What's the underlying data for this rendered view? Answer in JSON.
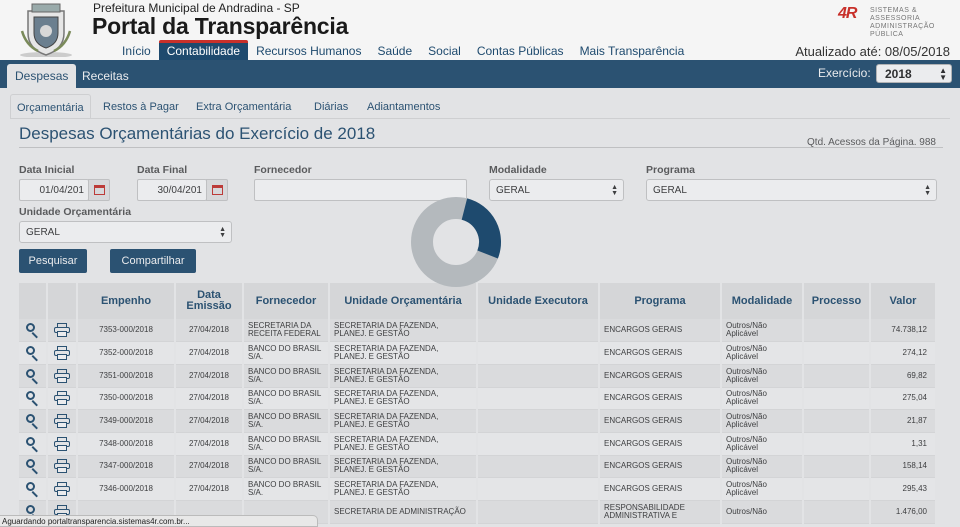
{
  "header": {
    "city": "Prefeitura Municipal de Andradina - SP",
    "portal_title": "Portal da Transparência",
    "updated": "Atualizado até: 08/05/2018",
    "brand": {
      "mark": "4R",
      "line1": "SISTEMAS & ASSESSORIA",
      "line2": "ADMINISTRAÇÃO PÚBLICA"
    },
    "nav": [
      {
        "label": "Início"
      },
      {
        "label": "Contabilidade"
      },
      {
        "label": "Recursos Humanos"
      },
      {
        "label": "Saúde"
      },
      {
        "label": "Social"
      },
      {
        "label": "Contas Públicas"
      },
      {
        "label": "Mais Transparência"
      }
    ]
  },
  "tabs": {
    "despesas": "Despesas",
    "receitas": "Receitas",
    "exercicio_label": "Exercício:",
    "exercicio_value": "2018"
  },
  "subtabs": [
    {
      "label": "Orçamentária"
    },
    {
      "label": "Restos à Pagar"
    },
    {
      "label": "Extra Orçamentária"
    },
    {
      "label": "Diárias"
    },
    {
      "label": "Adiantamentos"
    }
  ],
  "page": {
    "title": "Despesas Orçamentárias do Exercício de 2018",
    "access": "Qtd. Acessos da Página. 988"
  },
  "filters": {
    "data_inicial_label": "Data Inicial",
    "data_inicial": "01/04/201",
    "data_final_label": "Data Final",
    "data_final": "30/04/201",
    "fornecedor_label": "Fornecedor",
    "fornecedor": "",
    "modalidade_label": "Modalidade",
    "modalidade": "GERAL",
    "programa_label": "Programa",
    "programa": "GERAL",
    "unidade_label": "Unidade Orçamentária",
    "unidade": "GERAL",
    "pesquisar": "Pesquisar",
    "compartilhar": "Compartilhar"
  },
  "loading": {
    "progress": 0.27
  },
  "table": {
    "headers": [
      "Empenho",
      "Data Emissão",
      "Fornecedor",
      "Unidade Orçamentária",
      "Unidade Executora",
      "Programa",
      "Modalidade",
      "Processo",
      "Valor"
    ],
    "rows": [
      {
        "empenho": "7353-000/2018",
        "data": "27/04/2018",
        "fornecedor": "SECRETARIA DA RECEITA FEDERAL",
        "unidade": "SECRETARIA DA FAZENDA, PLANEJ. E GESTÃO",
        "executora": "",
        "programa": "ENCARGOS GERAIS",
        "modalidade": "Outros/Não Aplicável",
        "processo": "",
        "valor": "74.738,12"
      },
      {
        "empenho": "7352-000/2018",
        "data": "27/04/2018",
        "fornecedor": "BANCO DO BRASIL S/A.",
        "unidade": "SECRETARIA DA FAZENDA, PLANEJ. E GESTÃO",
        "executora": "",
        "programa": "ENCARGOS GERAIS",
        "modalidade": "Outros/Não Aplicável",
        "processo": "",
        "valor": "274,12"
      },
      {
        "empenho": "7351-000/2018",
        "data": "27/04/2018",
        "fornecedor": "BANCO DO BRASIL S/A.",
        "unidade": "SECRETARIA DA FAZENDA, PLANEJ. E GESTÃO",
        "executora": "",
        "programa": "ENCARGOS GERAIS",
        "modalidade": "Outros/Não Aplicável",
        "processo": "",
        "valor": "69,82"
      },
      {
        "empenho": "7350-000/2018",
        "data": "27/04/2018",
        "fornecedor": "BANCO DO BRASIL S/A.",
        "unidade": "SECRETARIA DA FAZENDA, PLANEJ. E GESTÃO",
        "executora": "",
        "programa": "ENCARGOS GERAIS",
        "modalidade": "Outros/Não Aplicável",
        "processo": "",
        "valor": "275,04"
      },
      {
        "empenho": "7349-000/2018",
        "data": "27/04/2018",
        "fornecedor": "BANCO DO BRASIL S/A.",
        "unidade": "SECRETARIA DA FAZENDA, PLANEJ. E GESTÃO",
        "executora": "",
        "programa": "ENCARGOS GERAIS",
        "modalidade": "Outros/Não Aplicável",
        "processo": "",
        "valor": "21,87"
      },
      {
        "empenho": "7348-000/2018",
        "data": "27/04/2018",
        "fornecedor": "BANCO DO BRASIL S/A.",
        "unidade": "SECRETARIA DA FAZENDA, PLANEJ. E GESTÃO",
        "executora": "",
        "programa": "ENCARGOS GERAIS",
        "modalidade": "Outros/Não Aplicável",
        "processo": "",
        "valor": "1,31"
      },
      {
        "empenho": "7347-000/2018",
        "data": "27/04/2018",
        "fornecedor": "BANCO DO BRASIL S/A.",
        "unidade": "SECRETARIA DA FAZENDA, PLANEJ. E GESTÃO",
        "executora": "",
        "programa": "ENCARGOS GERAIS",
        "modalidade": "Outros/Não Aplicável",
        "processo": "",
        "valor": "158,14"
      },
      {
        "empenho": "7346-000/2018",
        "data": "27/04/2018",
        "fornecedor": "BANCO DO BRASIL S/A.",
        "unidade": "SECRETARIA DA FAZENDA, PLANEJ. E GESTÃO",
        "executora": "",
        "programa": "ENCARGOS GERAIS",
        "modalidade": "Outros/Não Aplicável",
        "processo": "",
        "valor": "295,43"
      },
      {
        "empenho": "",
        "data": "",
        "fornecedor": "",
        "unidade": "SECRETARIA DE ADMINISTRAÇÃO",
        "executora": "",
        "programa": "RESPONSABILIDADE ADMINISTRATIVA E",
        "modalidade": "Outros/Não",
        "processo": "",
        "valor": "1.476,00"
      }
    ]
  },
  "status_bar": "Aguardando portaltransparencia.sistemas4r.com.br...",
  "colors": {
    "primary": "#1e4a6e",
    "accent": "#c8302a",
    "background": "#f5f5f5"
  }
}
